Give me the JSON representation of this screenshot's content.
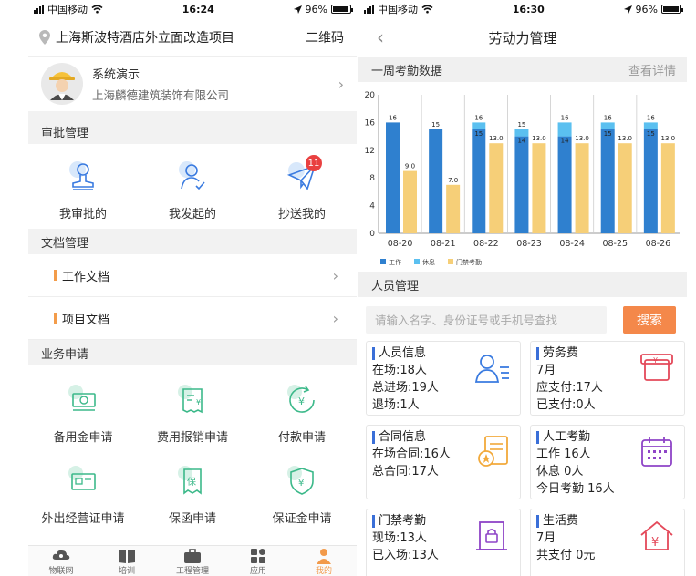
{
  "left": {
    "status": {
      "carrier": "中国移动",
      "time": "16:24",
      "battery": "96%"
    },
    "project_title": "上海斯波特酒店外立面改造项目",
    "qr_label": "二维码",
    "user": {
      "name": "系统演示",
      "company": "上海麟德建筑装饰有限公司"
    },
    "approval": {
      "title": "审批管理",
      "items": [
        {
          "label": "我审批的",
          "icon": "stamp-icon"
        },
        {
          "label": "我发起的",
          "icon": "user-check-icon"
        },
        {
          "label": "抄送我的",
          "icon": "paper-plane-icon",
          "badge": "11"
        }
      ]
    },
    "docs": {
      "title": "文档管理",
      "items": [
        "工作文档",
        "项目文档"
      ]
    },
    "business": {
      "title": "业务申请",
      "items": [
        {
          "label": "备用金申请",
          "icon": "cash-icon"
        },
        {
          "label": "费用报销申请",
          "icon": "receipt-icon"
        },
        {
          "label": "付款申请",
          "icon": "payment-icon"
        },
        {
          "label": "外出经营证申请",
          "icon": "certificate-icon"
        },
        {
          "label": "保函申请",
          "icon": "guarantee-icon"
        },
        {
          "label": "保证金申请",
          "icon": "deposit-icon"
        }
      ]
    },
    "tabs": [
      "物联网",
      "培训",
      "工程管理",
      "应用",
      "我的"
    ]
  },
  "right": {
    "status": {
      "carrier": "中国移动",
      "time": "16:30",
      "battery": "96%"
    },
    "nav_title": "劳动力管理",
    "attendance": {
      "title": "一周考勤数据",
      "more": "查看详情"
    },
    "chart_data": {
      "type": "bar",
      "categories": [
        "08-20",
        "08-21",
        "08-22",
        "08-23",
        "08-24",
        "08-25",
        "08-26"
      ],
      "series": [
        {
          "name": "工作",
          "values": [
            16,
            15,
            15,
            14,
            14,
            15,
            15
          ],
          "labels": [
            "16",
            "15",
            "15",
            "14",
            "14",
            "15",
            "15"
          ],
          "color": "#2f80cf"
        },
        {
          "name": "休息",
          "values": [
            0,
            0,
            1,
            1,
            2,
            1,
            1
          ],
          "color": "#5bc0f0"
        },
        {
          "name": "门禁考勤",
          "values": [
            9,
            7,
            13,
            13,
            13,
            13,
            13
          ],
          "labels": [
            "9.0",
            "7.0",
            "13.0",
            "13.0",
            "13.0",
            "13.0",
            "13.0"
          ],
          "color": "#f6cf78"
        }
      ],
      "stack_totals": [
        "16",
        "15",
        "16",
        "15",
        "16",
        "16",
        "16"
      ],
      "yticks": [
        0,
        4,
        8,
        12,
        16,
        20
      ],
      "ylim": [
        0,
        20
      ],
      "legend": "bottom-left",
      "grid": false
    },
    "people": {
      "title": "人员管理"
    },
    "search": {
      "placeholder": "请输入名字、身份证号或手机号查找",
      "button": "搜索"
    },
    "cards": [
      {
        "title": "人员信息",
        "lines": [
          "在场:18人",
          "总进场:19人",
          "退场:1人"
        ],
        "icon": "people-list-icon"
      },
      {
        "title": "劳务费",
        "lines": [
          "7月",
          "应支付:17人",
          "已支付:0人"
        ],
        "icon": "wallet-icon"
      },
      {
        "title": "合同信息",
        "lines": [
          "在场合同:16人",
          "总合同:17人"
        ],
        "icon": "contract-icon"
      },
      {
        "title": "人工考勤",
        "lines": [
          "工作 16人",
          "休息 0人",
          "今日考勤 16人"
        ],
        "icon": "calendar-icon"
      },
      {
        "title": "门禁考勤",
        "lines": [
          "现场:13人",
          "已入场:13人"
        ],
        "icon": "gate-icon"
      },
      {
        "title": "生活费",
        "lines": [
          "7月",
          "共支付 0元"
        ],
        "icon": "house-yen-icon"
      }
    ]
  }
}
